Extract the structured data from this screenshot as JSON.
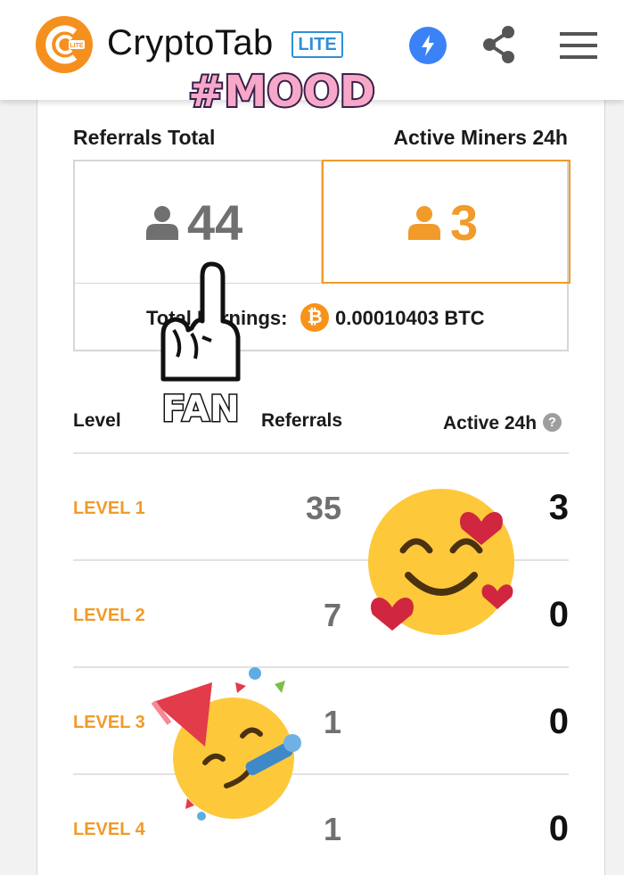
{
  "header": {
    "app_name": "CryptoTab",
    "badge": "LITE",
    "icons": [
      "cryptotab-logo-icon",
      "bolt-icon",
      "share-icon",
      "menu-icon"
    ],
    "accent": "#f09b2a"
  },
  "stats": {
    "referrals_total_label": "Referrals Total",
    "active_miners_label": "Active Miners 24h",
    "referrals_total": "44",
    "active_miners": "3",
    "earnings_label": "Total Earnings:",
    "earnings_value": "0.00010403 BTC"
  },
  "table": {
    "headers": {
      "level": "Level",
      "referrals": "Referrals",
      "active": "Active 24h"
    },
    "rows": [
      {
        "level": "LEVEL 1",
        "referrals": "35",
        "active": "3"
      },
      {
        "level": "LEVEL 2",
        "referrals": "7",
        "active": "0"
      },
      {
        "level": "LEVEL 3",
        "referrals": "1",
        "active": "0"
      },
      {
        "level": "LEVEL 4",
        "referrals": "1",
        "active": "0"
      }
    ]
  },
  "stickers": {
    "mood_text": "#MOOD",
    "fan_text": "FAN"
  }
}
